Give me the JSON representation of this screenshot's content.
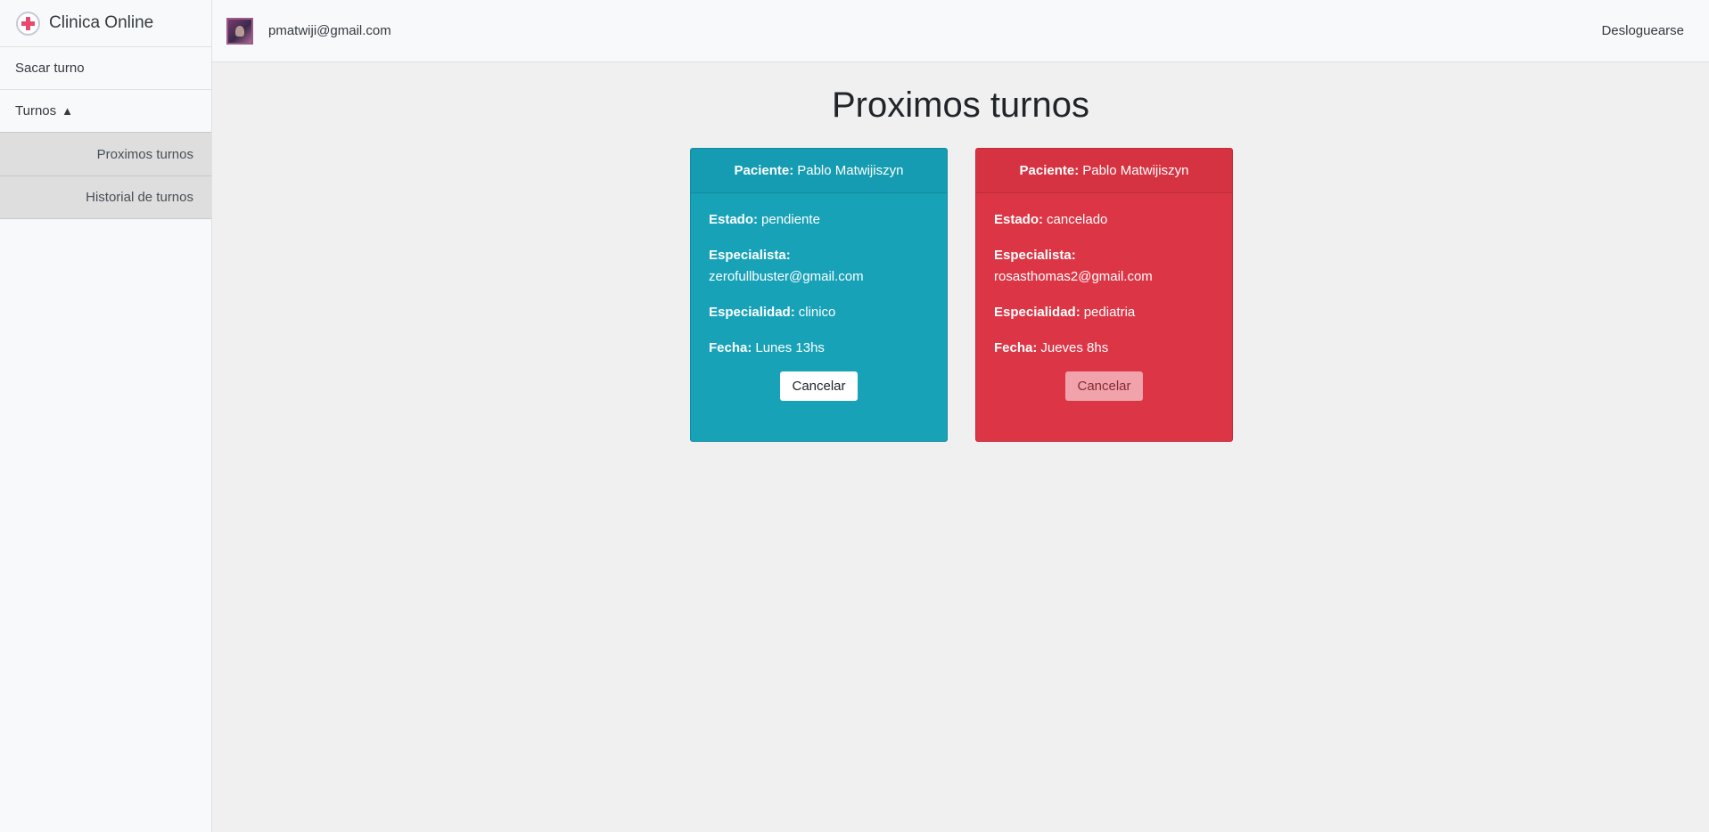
{
  "app": {
    "title": "Clinica Online"
  },
  "sidebar": {
    "items": [
      {
        "label": "Sacar turno"
      },
      {
        "label": "Turnos",
        "caret": "▲"
      }
    ],
    "subitems": [
      {
        "label": "Proximos turnos"
      },
      {
        "label": "Historial de turnos"
      }
    ]
  },
  "header": {
    "user_email": "pmatwiji@gmail.com",
    "logout_label": "Desloguearse"
  },
  "main": {
    "title": "Proximos turnos",
    "labels": {
      "paciente": "Paciente:",
      "estado": "Estado:",
      "especialista": "Especialista:",
      "especialidad": "Especialidad:",
      "fecha": "Fecha:"
    },
    "cards": [
      {
        "color": "#17a2b8",
        "paciente": "Pablo Matwijiszyn",
        "estado": "pendiente",
        "especialista": "zerofullbuster@gmail.com",
        "especialidad": "clinico",
        "fecha": "Lunes 13hs",
        "button_label": "Cancelar"
      },
      {
        "color": "#dc3545",
        "paciente": "Pablo Matwijiszyn",
        "estado": "cancelado",
        "especialista": "rosasthomas2@gmail.com",
        "especialidad": "pediatria",
        "fecha": "Jueves 8hs",
        "button_label": "Cancelar"
      }
    ]
  }
}
